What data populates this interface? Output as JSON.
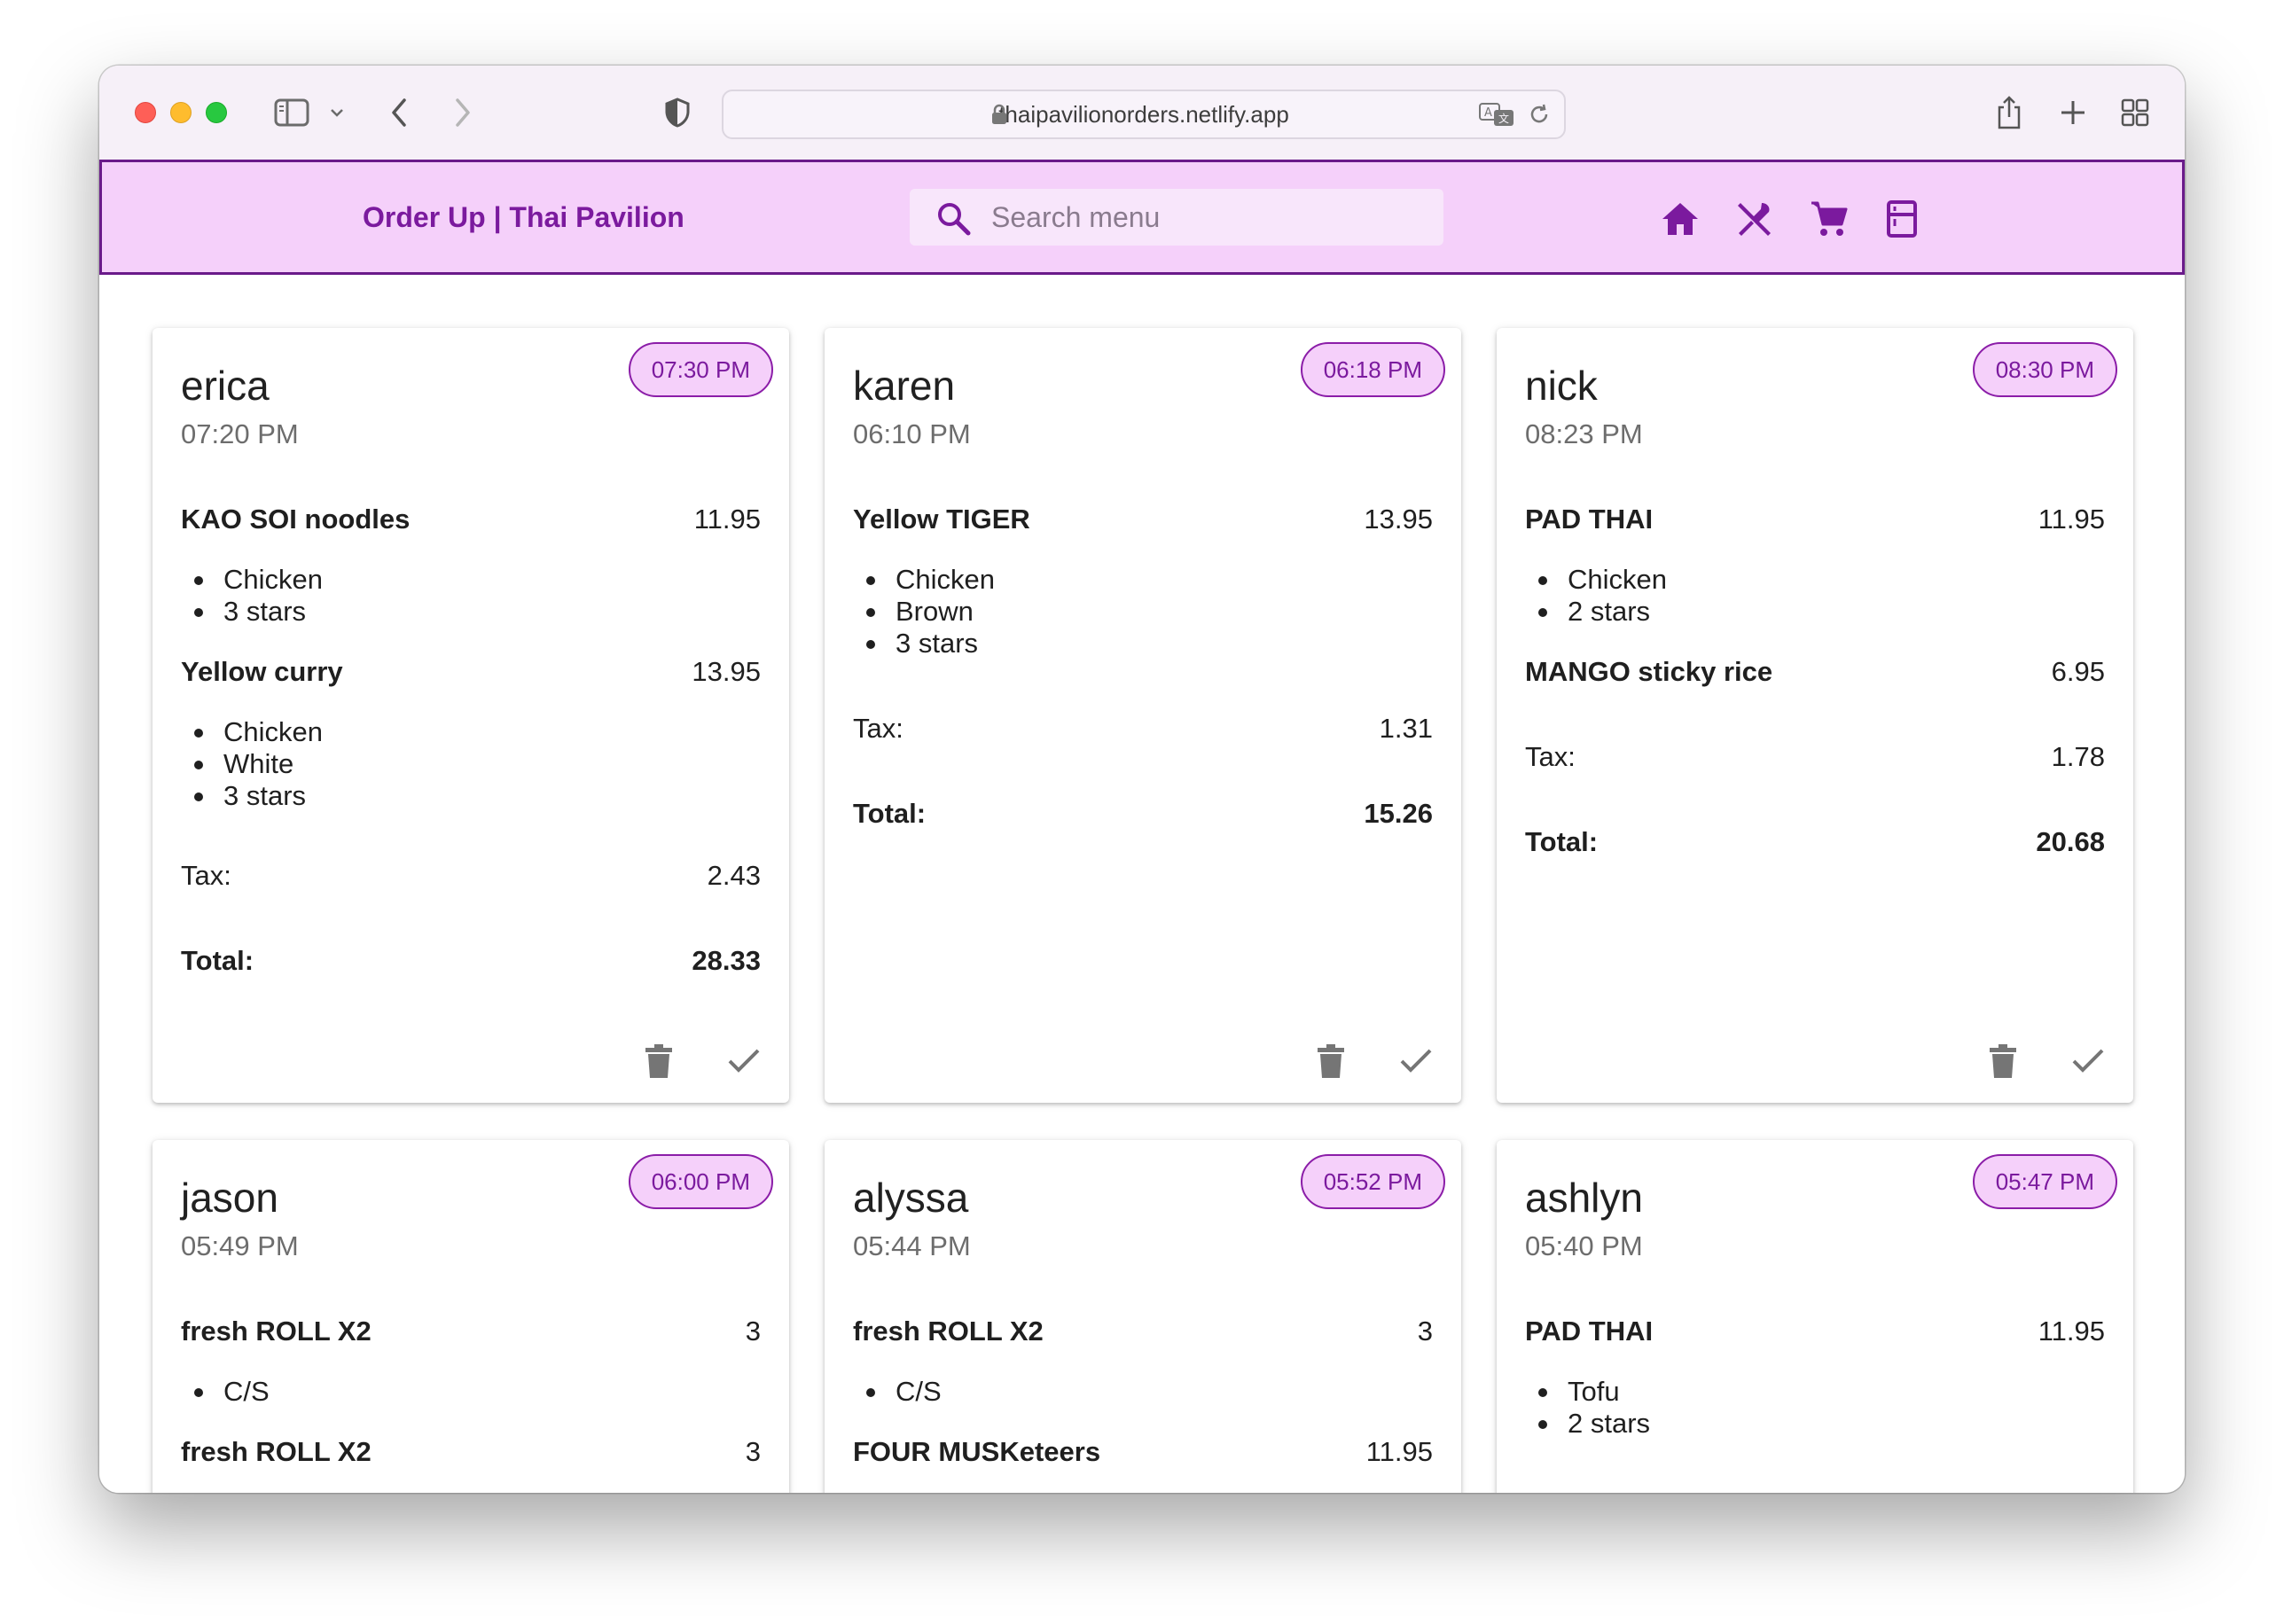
{
  "browser": {
    "url": "thaipavilionorders.netlify.app"
  },
  "app": {
    "title": "Order Up | Thai Pavilion",
    "search_placeholder": "Search menu",
    "accent": "#7b1a9e",
    "bar_bg": "#f5d0fa",
    "nav": [
      "home-icon",
      "restaurant-icon",
      "cart-icon",
      "kitchen-icon"
    ]
  },
  "orders": [
    {
      "name": "erica",
      "placed": "07:20 PM",
      "due": "07:30 PM",
      "items": [
        {
          "name": "KAO SOI noodles",
          "price": "11.95",
          "mods": [
            "Chicken",
            "3 stars"
          ]
        },
        {
          "name": "Yellow curry",
          "price": "13.95",
          "mods": [
            "Chicken",
            "White",
            "3 stars"
          ]
        }
      ],
      "tax_label": "Tax:",
      "tax": "2.43",
      "total_label": "Total:",
      "total": "28.33"
    },
    {
      "name": "karen",
      "placed": "06:10 PM",
      "due": "06:18 PM",
      "items": [
        {
          "name": "Yellow TIGER",
          "price": "13.95",
          "mods": [
            "Chicken",
            "Brown",
            "3 stars"
          ]
        }
      ],
      "tax_label": "Tax:",
      "tax": "1.31",
      "total_label": "Total:",
      "total": "15.26"
    },
    {
      "name": "nick",
      "placed": "08:23 PM",
      "due": "08:30 PM",
      "items": [
        {
          "name": "PAD THAI",
          "price": "11.95",
          "mods": [
            "Chicken",
            "2 stars"
          ]
        },
        {
          "name": "MANGO sticky rice",
          "price": "6.95",
          "mods": []
        }
      ],
      "tax_label": "Tax:",
      "tax": "1.78",
      "total_label": "Total:",
      "total": "20.68"
    },
    {
      "name": "jason",
      "placed": "05:49 PM",
      "due": "06:00 PM",
      "items": [
        {
          "name": "fresh ROLL X2",
          "price": "3",
          "mods": [
            "C/S"
          ]
        },
        {
          "name": "fresh ROLL X2",
          "price": "3",
          "mods": []
        }
      ]
    },
    {
      "name": "alyssa",
      "placed": "05:44 PM",
      "due": "05:52 PM",
      "items": [
        {
          "name": "fresh ROLL X2",
          "price": "3",
          "mods": [
            "C/S"
          ]
        },
        {
          "name": "FOUR MUSKeteers",
          "price": "11.95",
          "mods": []
        }
      ]
    },
    {
      "name": "ashlyn",
      "placed": "05:40 PM",
      "due": "05:47 PM",
      "items": [
        {
          "name": "PAD THAI",
          "price": "11.95",
          "mods": [
            "Tofu",
            "2 stars"
          ]
        }
      ]
    }
  ]
}
